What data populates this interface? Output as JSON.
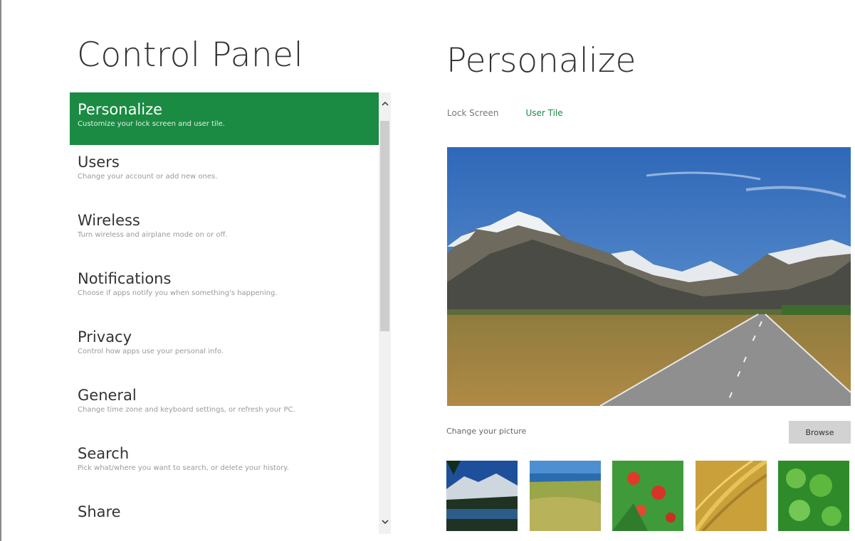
{
  "control_panel": {
    "title": "Control Panel",
    "items": [
      {
        "label": "Personalize",
        "description": "Customize your lock screen and user tile."
      },
      {
        "label": "Users",
        "description": "Change your account or add new ones."
      },
      {
        "label": "Wireless",
        "description": "Turn wireless and airplane mode on or off."
      },
      {
        "label": "Notifications",
        "description": "Choose if apps notify you when something's happening."
      },
      {
        "label": "Privacy",
        "description": "Control how apps use your personal info."
      },
      {
        "label": "General",
        "description": "Change time zone and keyboard settings, or refresh your PC."
      },
      {
        "label": "Search",
        "description": "Pick what/where you want to search, or delete your history."
      },
      {
        "label": "Share",
        "description": ""
      }
    ],
    "selected_index": 0
  },
  "personalize": {
    "title": "Personalize",
    "tabs": [
      {
        "label": "Lock Screen"
      },
      {
        "label": "User Tile"
      }
    ],
    "active_tab": "User Tile",
    "change_picture_label": "Change your picture",
    "browse_label": "Browse",
    "thumbnails": [
      "mountain-lake",
      "green-hills",
      "red-flowers",
      "golden-grass",
      "green-clover"
    ]
  },
  "icons": {
    "scroll_up": "chevron-up-icon",
    "scroll_down": "chevron-down-icon"
  },
  "colors": {
    "accent": "#1b8a43",
    "scrollbar_track": "#f1f1f1",
    "scrollbar_thumb": "#cdcdcd",
    "button": "#d2d2d2"
  }
}
